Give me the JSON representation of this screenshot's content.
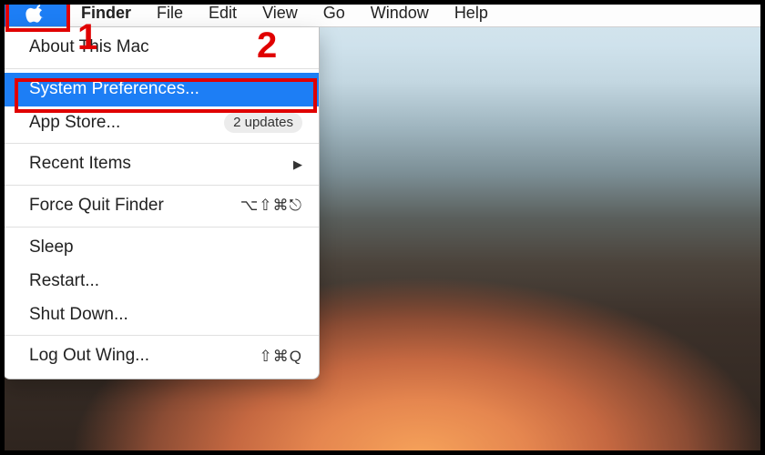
{
  "menubar": {
    "app": "Finder",
    "items": [
      "File",
      "Edit",
      "View",
      "Go",
      "Window",
      "Help"
    ]
  },
  "apple_menu": {
    "about": "About This Mac",
    "system_prefs": "System Preferences...",
    "app_store": {
      "label": "App Store...",
      "badge": "2 updates"
    },
    "recent_items": "Recent Items",
    "force_quit": {
      "label": "Force Quit Finder",
      "shortcut": "⌥⇧⌘⎋"
    },
    "sleep": "Sleep",
    "restart": "Restart...",
    "shut_down": "Shut Down...",
    "log_out": {
      "label": "Log Out Wing...",
      "shortcut": "⇧⌘Q"
    }
  },
  "annotations": {
    "label1": "1",
    "label2": "2"
  }
}
